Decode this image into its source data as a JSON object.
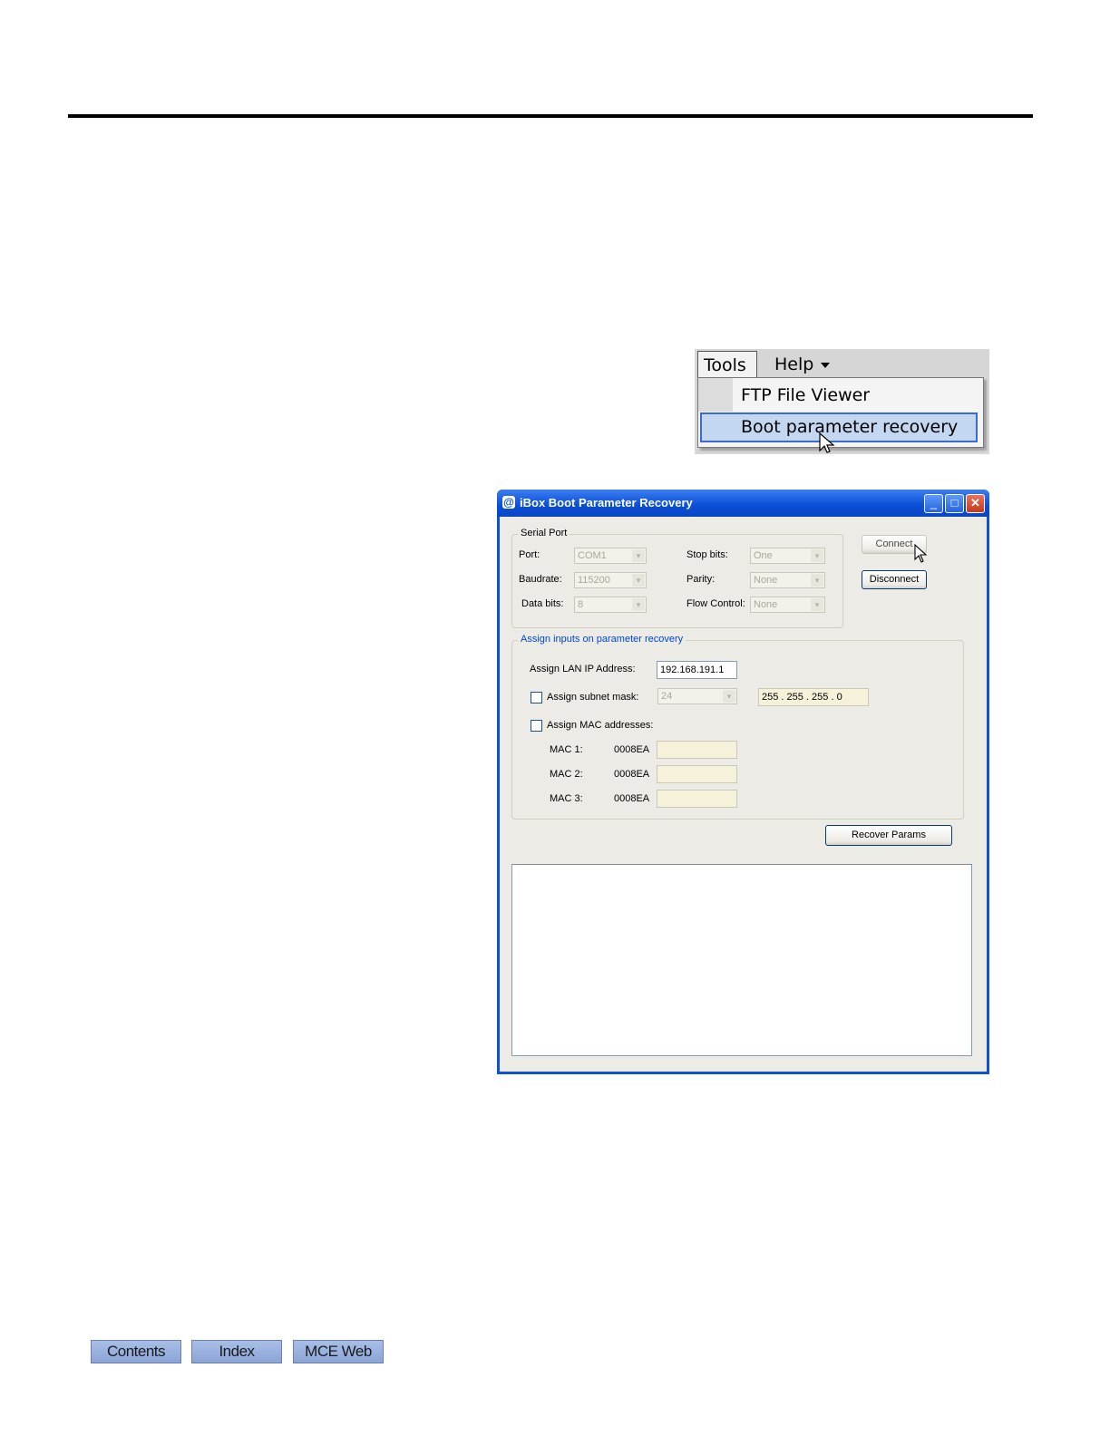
{
  "menu": {
    "tools_label": "Tools",
    "help_label": "Help",
    "items": [
      {
        "label": "FTP File Viewer"
      },
      {
        "label": "Boot parameter recovery"
      }
    ]
  },
  "dialog": {
    "title": "iBox Boot Parameter Recovery",
    "serial_port": {
      "legend": "Serial Port",
      "port_label": "Port:",
      "port_value": "COM1",
      "baudrate_label": "Baudrate:",
      "baudrate_value": "115200",
      "databits_label": "Data bits:",
      "databits_value": "8",
      "stopbits_label": "Stop bits:",
      "stopbits_value": "One",
      "parity_label": "Parity:",
      "parity_value": "None",
      "flow_label": "Flow Control:",
      "flow_value": "None"
    },
    "connect_label": "Connect",
    "disconnect_label": "Disconnect",
    "assign": {
      "legend": "Assign inputs on parameter recovery",
      "lan_ip_label": "Assign LAN IP Address:",
      "lan_ip_value": "192.168.191.1",
      "subnet_label": "Assign subnet mask:",
      "subnet_bits": "24",
      "subnet_mask": "255 . 255 . 255 . 0",
      "mac_label": "Assign MAC addresses:",
      "macs": [
        {
          "label": "MAC 1:",
          "prefix": "0008EA"
        },
        {
          "label": "MAC 2:",
          "prefix": "0008EA"
        },
        {
          "label": "MAC 3:",
          "prefix": "0008EA"
        }
      ]
    },
    "recover_label": "Recover Params"
  },
  "footer": {
    "contents": "Contents",
    "index": "Index",
    "mce_web": "MCE Web"
  },
  "colors": {
    "title_blue": "#0a4ed6",
    "legend_blue": "#0046d5",
    "menu_highlight": "#c4d7f0",
    "nav_button": "#9db4e0"
  }
}
